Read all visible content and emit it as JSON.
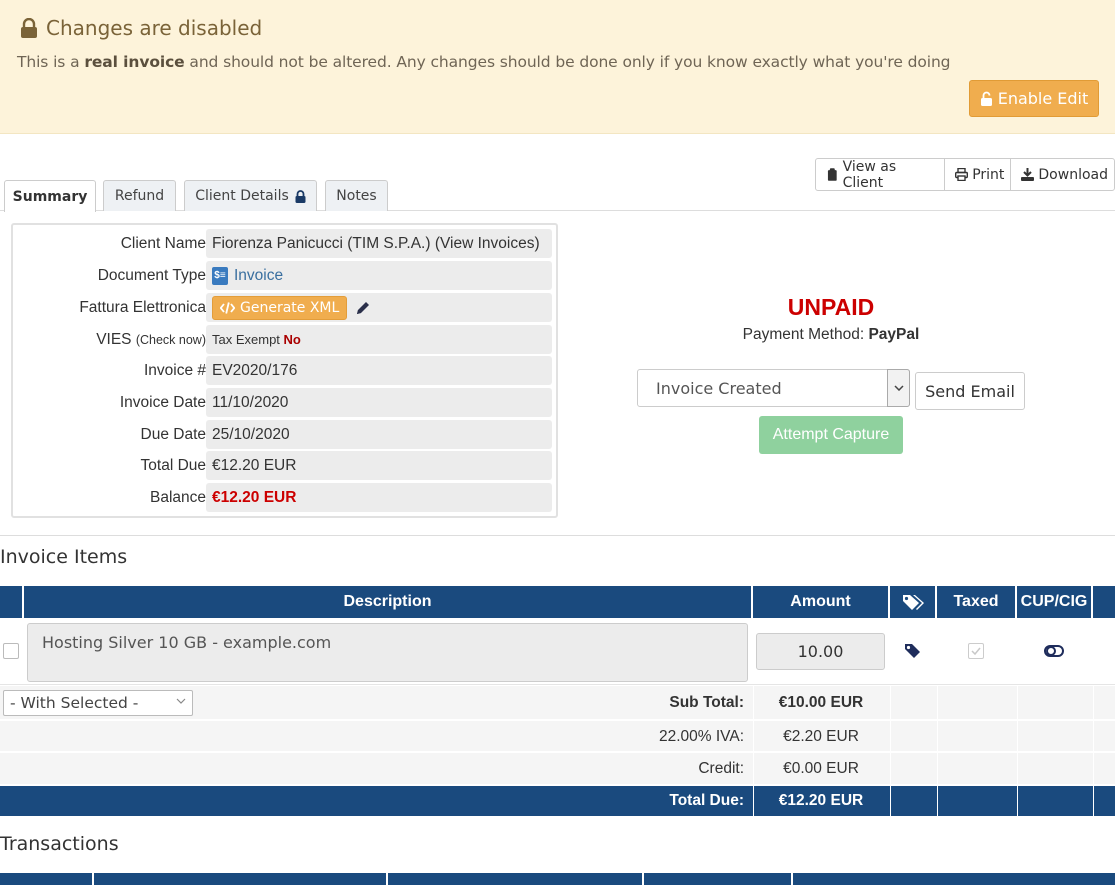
{
  "banner": {
    "title": "Changes are disabled",
    "text_pre": "This is a ",
    "text_bold": "real invoice",
    "text_post": " and should not be altered. Any changes should be done only if you know exactly what you're doing",
    "enable_label": "Enable Edit",
    "color": "#fdf3da"
  },
  "actions": {
    "view_client": "View as Client",
    "print": "Print",
    "download": "Download"
  },
  "tabs": {
    "summary": "Summary",
    "refund": "Refund",
    "client_details": "Client Details",
    "notes": "Notes"
  },
  "summary": {
    "client_name_label": "Client Name",
    "client_name": "Fiorenza Panicucci (TIM S.P.A.)",
    "view_invoices": "(View Invoices)",
    "doc_type_label": "Document Type",
    "doc_type": "Invoice",
    "fattura_label": "Fattura Elettronica",
    "generate_xml": "Generate XML",
    "vies_label": "VIES",
    "check_now": "(Check now)",
    "tax_exempt_label": "Tax Exempt",
    "tax_exempt_value": "No",
    "invoice_no_label": "Invoice #",
    "invoice_no": "EV2020/176",
    "invoice_date_label": "Invoice Date",
    "invoice_date": "11/10/2020",
    "due_date_label": "Due Date",
    "due_date": "25/10/2020",
    "total_due_label": "Total Due",
    "total_due": "€12.20 EUR",
    "balance_label": "Balance",
    "balance": "€12.20 EUR"
  },
  "status": {
    "state": "UNPAID",
    "payment_method_label": "Payment Method:",
    "payment_method": "PayPal",
    "email_template": "Invoice Created",
    "send_email": "Send Email",
    "attempt_capture": "Attempt Capture"
  },
  "items": {
    "title": "Invoice Items",
    "col_description": "Description",
    "col_amount": "Amount",
    "col_taxed": "Taxed",
    "col_cup": "CUP/CIG",
    "row_description": "Hosting Silver 10 GB - example.com",
    "row_amount": "10.00",
    "with_selected": "- With Selected -",
    "subtotal_label": "Sub Total:",
    "subtotal": "€10.00 EUR",
    "iva_label": "22.00% IVA:",
    "iva": "€2.20 EUR",
    "credit_label": "Credit:",
    "credit": "€0.00 EUR",
    "total_label": "Total Due:",
    "total": "€12.20 EUR",
    "header_color": "#1a4a7e"
  },
  "transactions": {
    "title": "Transactions"
  }
}
